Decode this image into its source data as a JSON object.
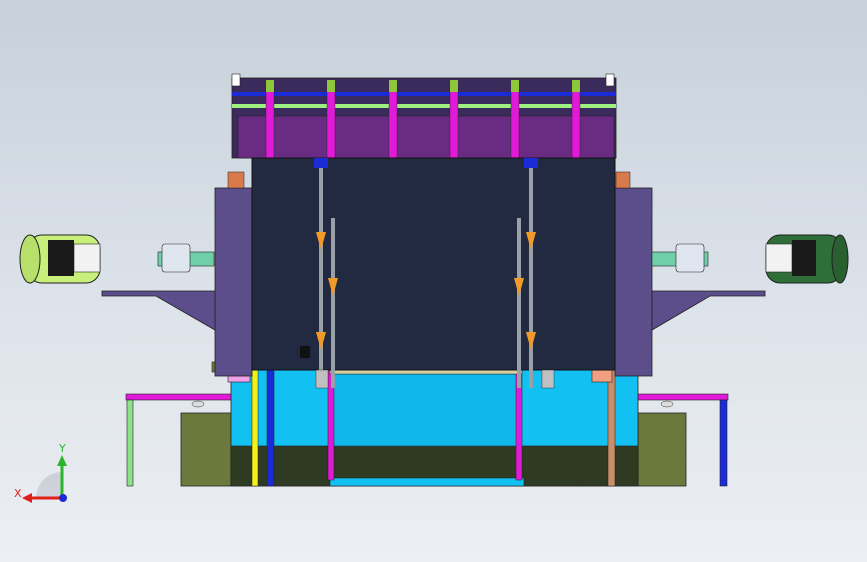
{
  "triad": {
    "x_label": "X",
    "y_label": "Y",
    "x_color": "#e0201b",
    "y_color": "#2bb52b",
    "z_color": "#1b2bd6"
  },
  "colors": {
    "background_top": "#c7d0db",
    "background_bottom": "#eceff3",
    "main_box": "#222a41",
    "side_wall": "#5b4e8a",
    "tank": "#12c0f2",
    "tank_dark": "#2e3a22",
    "left_motor": "#c8ef7a",
    "right_motor": "#2f6e38",
    "olive_block": "#6b7a3c",
    "magenta_rod": "#e01ad8",
    "top_frame": "#7a2a7a"
  }
}
